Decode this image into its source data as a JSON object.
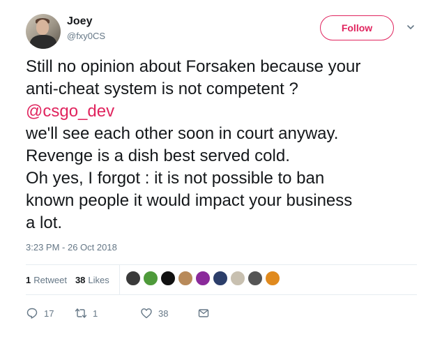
{
  "user": {
    "name": "Joey",
    "handle": "@fxy0CS"
  },
  "follow_label": "Follow",
  "tweet": {
    "lines": [
      "Still no opinion about Forsaken  because your",
      "anti-cheat system is not competent ?",
      "we'll see each other soon in court anyway.",
      "Revenge is a dish best served cold.",
      "Oh yes, I forgot : it is not possible to ban",
      "known people it would impact your business",
      "a lot."
    ],
    "mention": "@csgo_dev"
  },
  "timestamp": "3:23 PM - 26 Oct 2018",
  "stats": {
    "retweets_count": "1",
    "retweets_label": "Retweet",
    "likes_count": "38",
    "likes_label": "Likes"
  },
  "likers": [
    {
      "color": "#3a3a3a"
    },
    {
      "color": "#4e9a3a"
    },
    {
      "color": "#111111"
    },
    {
      "color": "#b88a5a"
    },
    {
      "color": "#8a2a9a"
    },
    {
      "color": "#2c3e6a"
    },
    {
      "color": "#c8c0b0"
    },
    {
      "color": "#555555"
    },
    {
      "color": "#e08a1e"
    }
  ],
  "actions": {
    "reply_count": "17",
    "retweet_count": "1",
    "like_count": "38"
  },
  "colors": {
    "accent": "#e0245e",
    "secondary_text": "#657786",
    "divider": "#e6ecf0"
  },
  "icons": [
    "reply-icon",
    "retweet-icon",
    "heart-icon",
    "message-icon",
    "chevron-down-icon"
  ]
}
